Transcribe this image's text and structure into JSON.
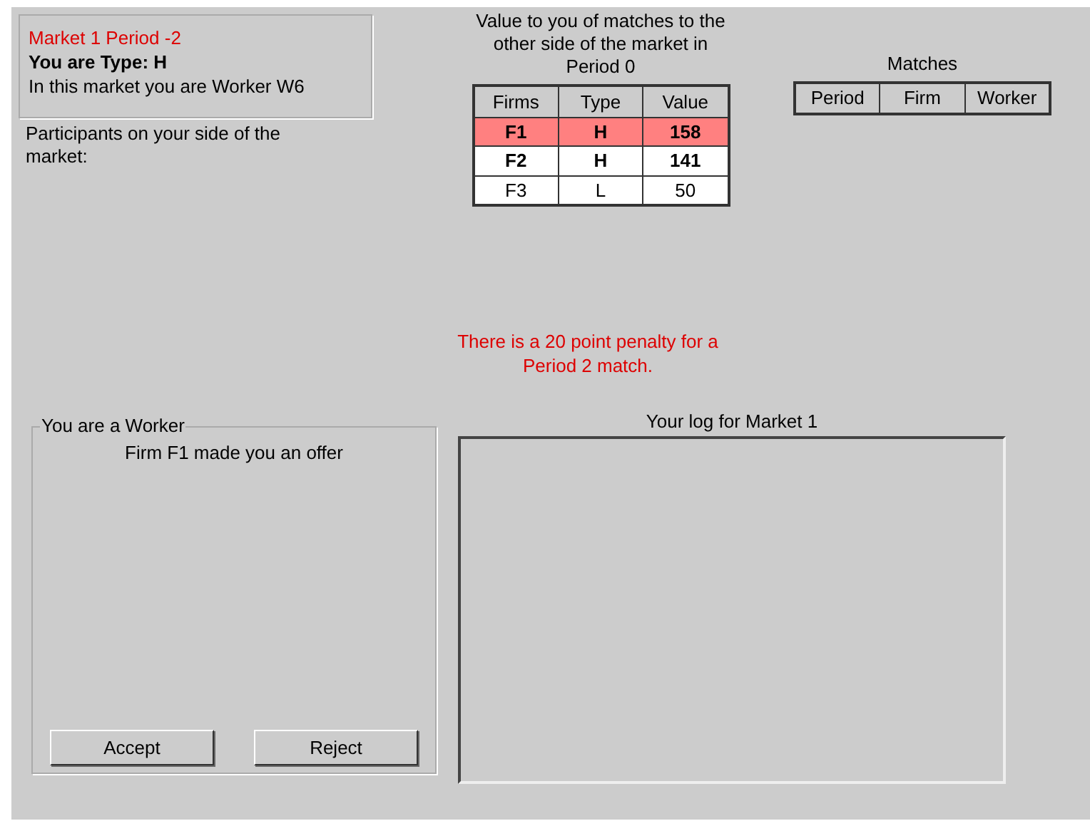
{
  "info": {
    "market_period": "Market 1 Period -2",
    "type_line": "You are Type: H",
    "role_line": "In this market you are Worker W6"
  },
  "participants_label": "Participants on your side of the market:",
  "values": {
    "title": "Value to you of matches to the other side of the market in Period 0",
    "columns": [
      "Firms",
      "Type",
      "Value"
    ],
    "rows": [
      {
        "cells": [
          "F1",
          "H",
          "158"
        ],
        "selected": true,
        "bold": true
      },
      {
        "cells": [
          "F2",
          "H",
          "141"
        ],
        "selected": false,
        "bold": true
      },
      {
        "cells": [
          "F3",
          "L",
          "50"
        ],
        "selected": false,
        "bold": false
      }
    ]
  },
  "matches": {
    "title": "Matches",
    "columns": [
      "Period",
      "Firm",
      "Worker"
    ]
  },
  "penalty": "There is a 20 point penalty for a Period 2 match.",
  "worker_panel": {
    "legend": "You are a Worker",
    "message": "Firm F1 made you an offer",
    "buttons": [
      "Accept",
      "Reject"
    ]
  },
  "log": {
    "title": "Your log for Market 1"
  }
}
